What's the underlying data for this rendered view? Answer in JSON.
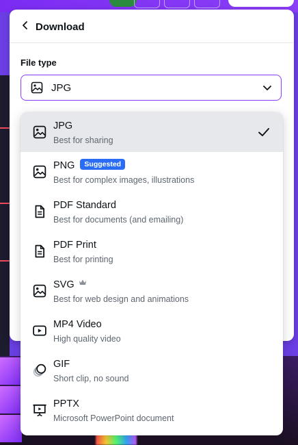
{
  "header": {
    "title": "Download",
    "back_icon": "chevron-left-icon"
  },
  "file_type": {
    "label": "File type",
    "selected": "JPG",
    "selected_icon": "image-icon"
  },
  "options": [
    {
      "name": "JPG",
      "description": "Best for sharing",
      "icon": "image-icon",
      "selected": true
    },
    {
      "name": "PNG",
      "description": "Best for complex images, illustrations",
      "icon": "image-icon",
      "badge": "Suggested"
    },
    {
      "name": "PDF Standard",
      "description": "Best for documents (and emailing)",
      "icon": "document-icon"
    },
    {
      "name": "PDF Print",
      "description": "Best for printing",
      "icon": "document-icon"
    },
    {
      "name": "SVG",
      "description": "Best for web design and animations",
      "icon": "image-icon",
      "premium": true
    },
    {
      "name": "MP4 Video",
      "description": "High quality video",
      "icon": "video-icon"
    },
    {
      "name": "GIF",
      "description": "Short clip, no sound",
      "icon": "gif-icon"
    },
    {
      "name": "PPTX",
      "description": "Microsoft PowerPoint document",
      "icon": "presentation-icon"
    }
  ],
  "colors": {
    "accent": "#8b3dff",
    "badge": "#2a6df4",
    "selected_row": "#e6e8eb",
    "text": "#0d1216",
    "muted_text": "#5e6670"
  }
}
